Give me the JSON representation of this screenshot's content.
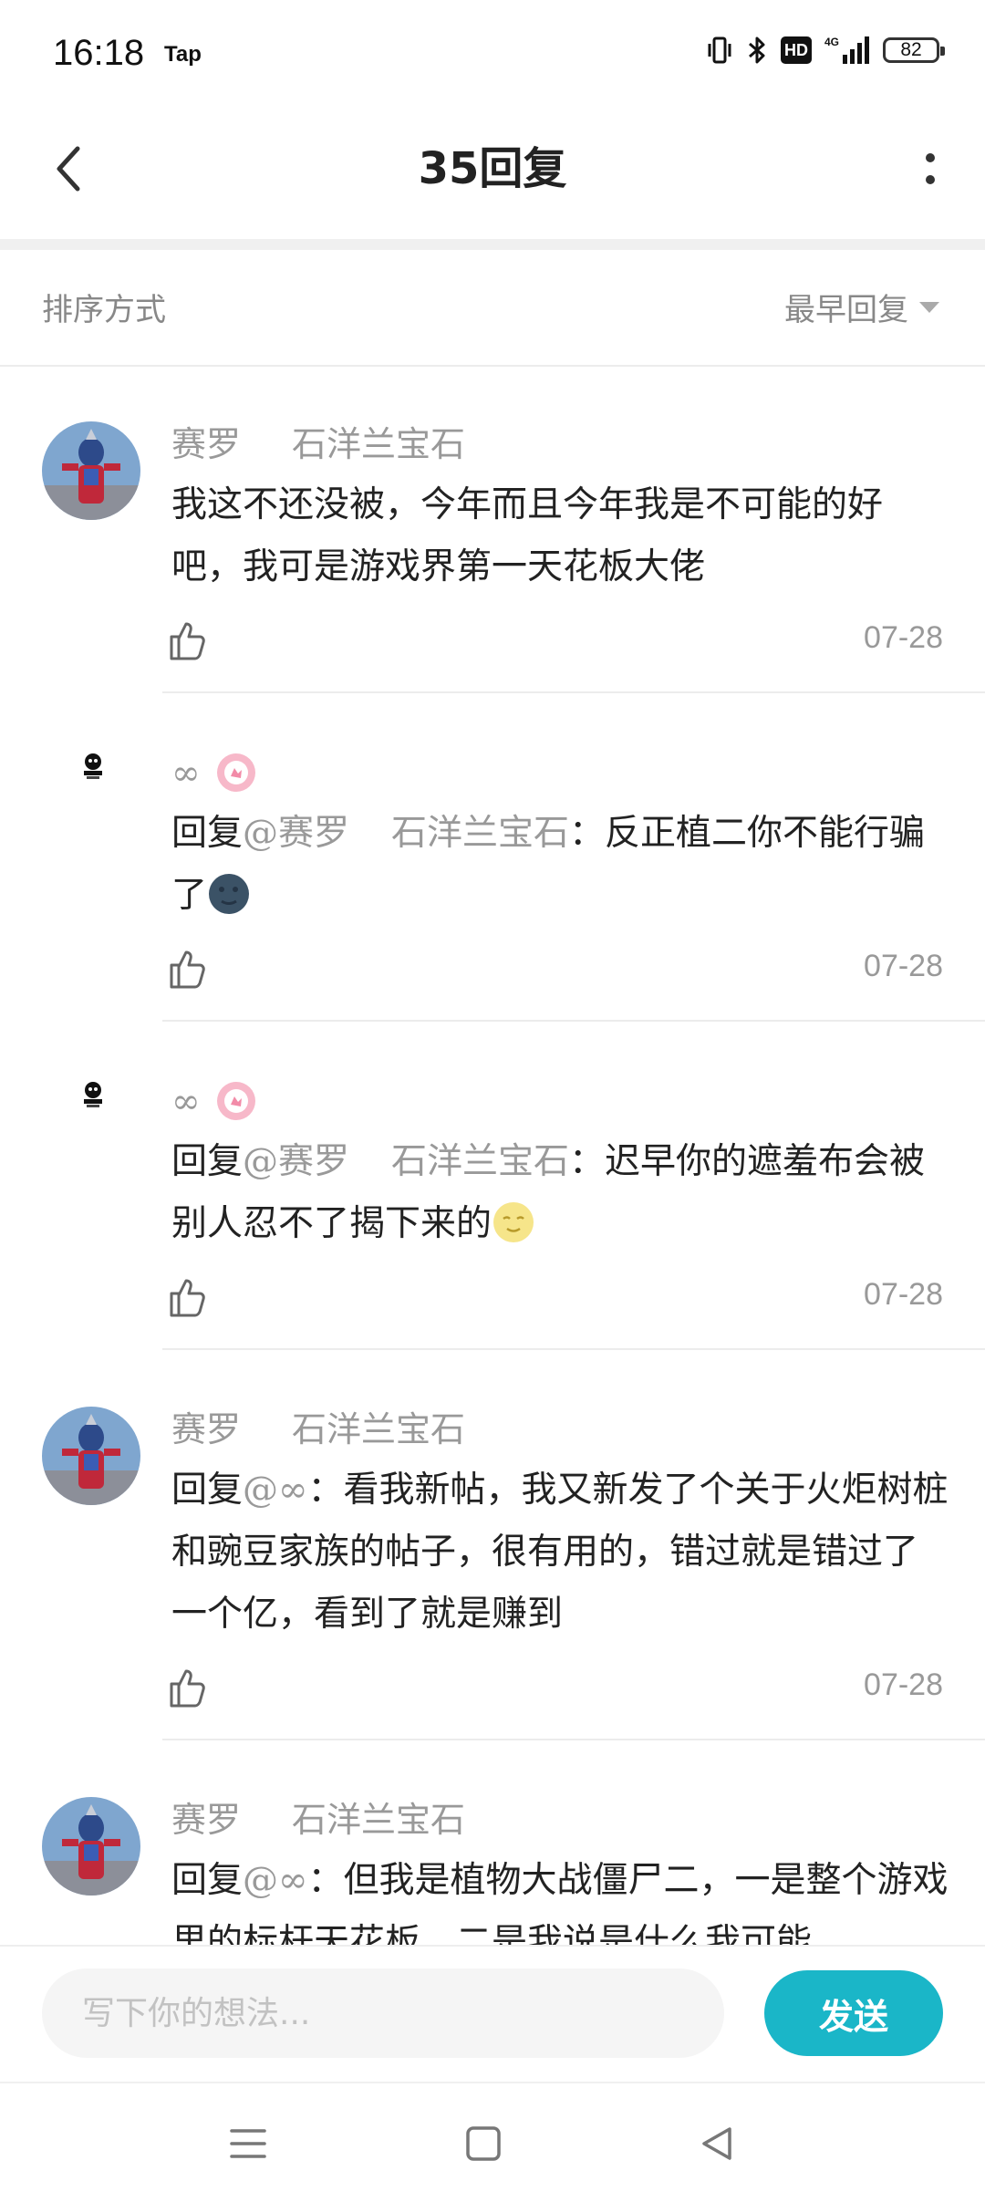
{
  "status_bar": {
    "time": "16:18",
    "carrier_app": "Tap",
    "hd_label": "HD",
    "network": "4G",
    "battery": "82"
  },
  "header": {
    "title": "35回复"
  },
  "sort": {
    "label": "排序方式",
    "selected": "最早回复"
  },
  "replies": [
    {
      "user": "赛罗",
      "user_suffix": "石洋兰宝石",
      "text": "我这不还没被，今年而且今年我是不可能的好吧，我可是游戏界第一天花板大佬",
      "date": "07-28"
    },
    {
      "user": "∞",
      "reply_prefix": "回复",
      "mention": "@赛罗",
      "mention_suffix": "石洋兰宝石",
      "text": "：反正植二你不能行骗了",
      "date": "07-28"
    },
    {
      "user": "∞",
      "reply_prefix": "回复",
      "mention": "@赛罗",
      "mention_suffix": "石洋兰宝石",
      "text": "：迟早你的遮羞布会被别人忍不了揭下来的",
      "date": "07-28"
    },
    {
      "user": "赛罗",
      "user_suffix": "石洋兰宝石",
      "reply_prefix": "回复",
      "mention": "@∞",
      "text": "：看我新帖，我又新发了个关于火炬树桩和豌豆家族的帖子，很有用的，错过就是错过了一个亿，看到了就是赚到",
      "date": "07-28"
    },
    {
      "user": "赛罗",
      "user_suffix": "石洋兰宝石",
      "reply_prefix": "回复",
      "mention": "@∞",
      "text": "：但我是植物大战僵尸二，一是整个游戏里的标杆天花板，二是我说是什么我可能",
      "date": ""
    }
  ],
  "composer": {
    "placeholder": "写下你的想法...",
    "send_label": "发送"
  },
  "colors": {
    "accent": "#1ab6c8",
    "muted_text": "#999999",
    "divider": "#ececec"
  }
}
